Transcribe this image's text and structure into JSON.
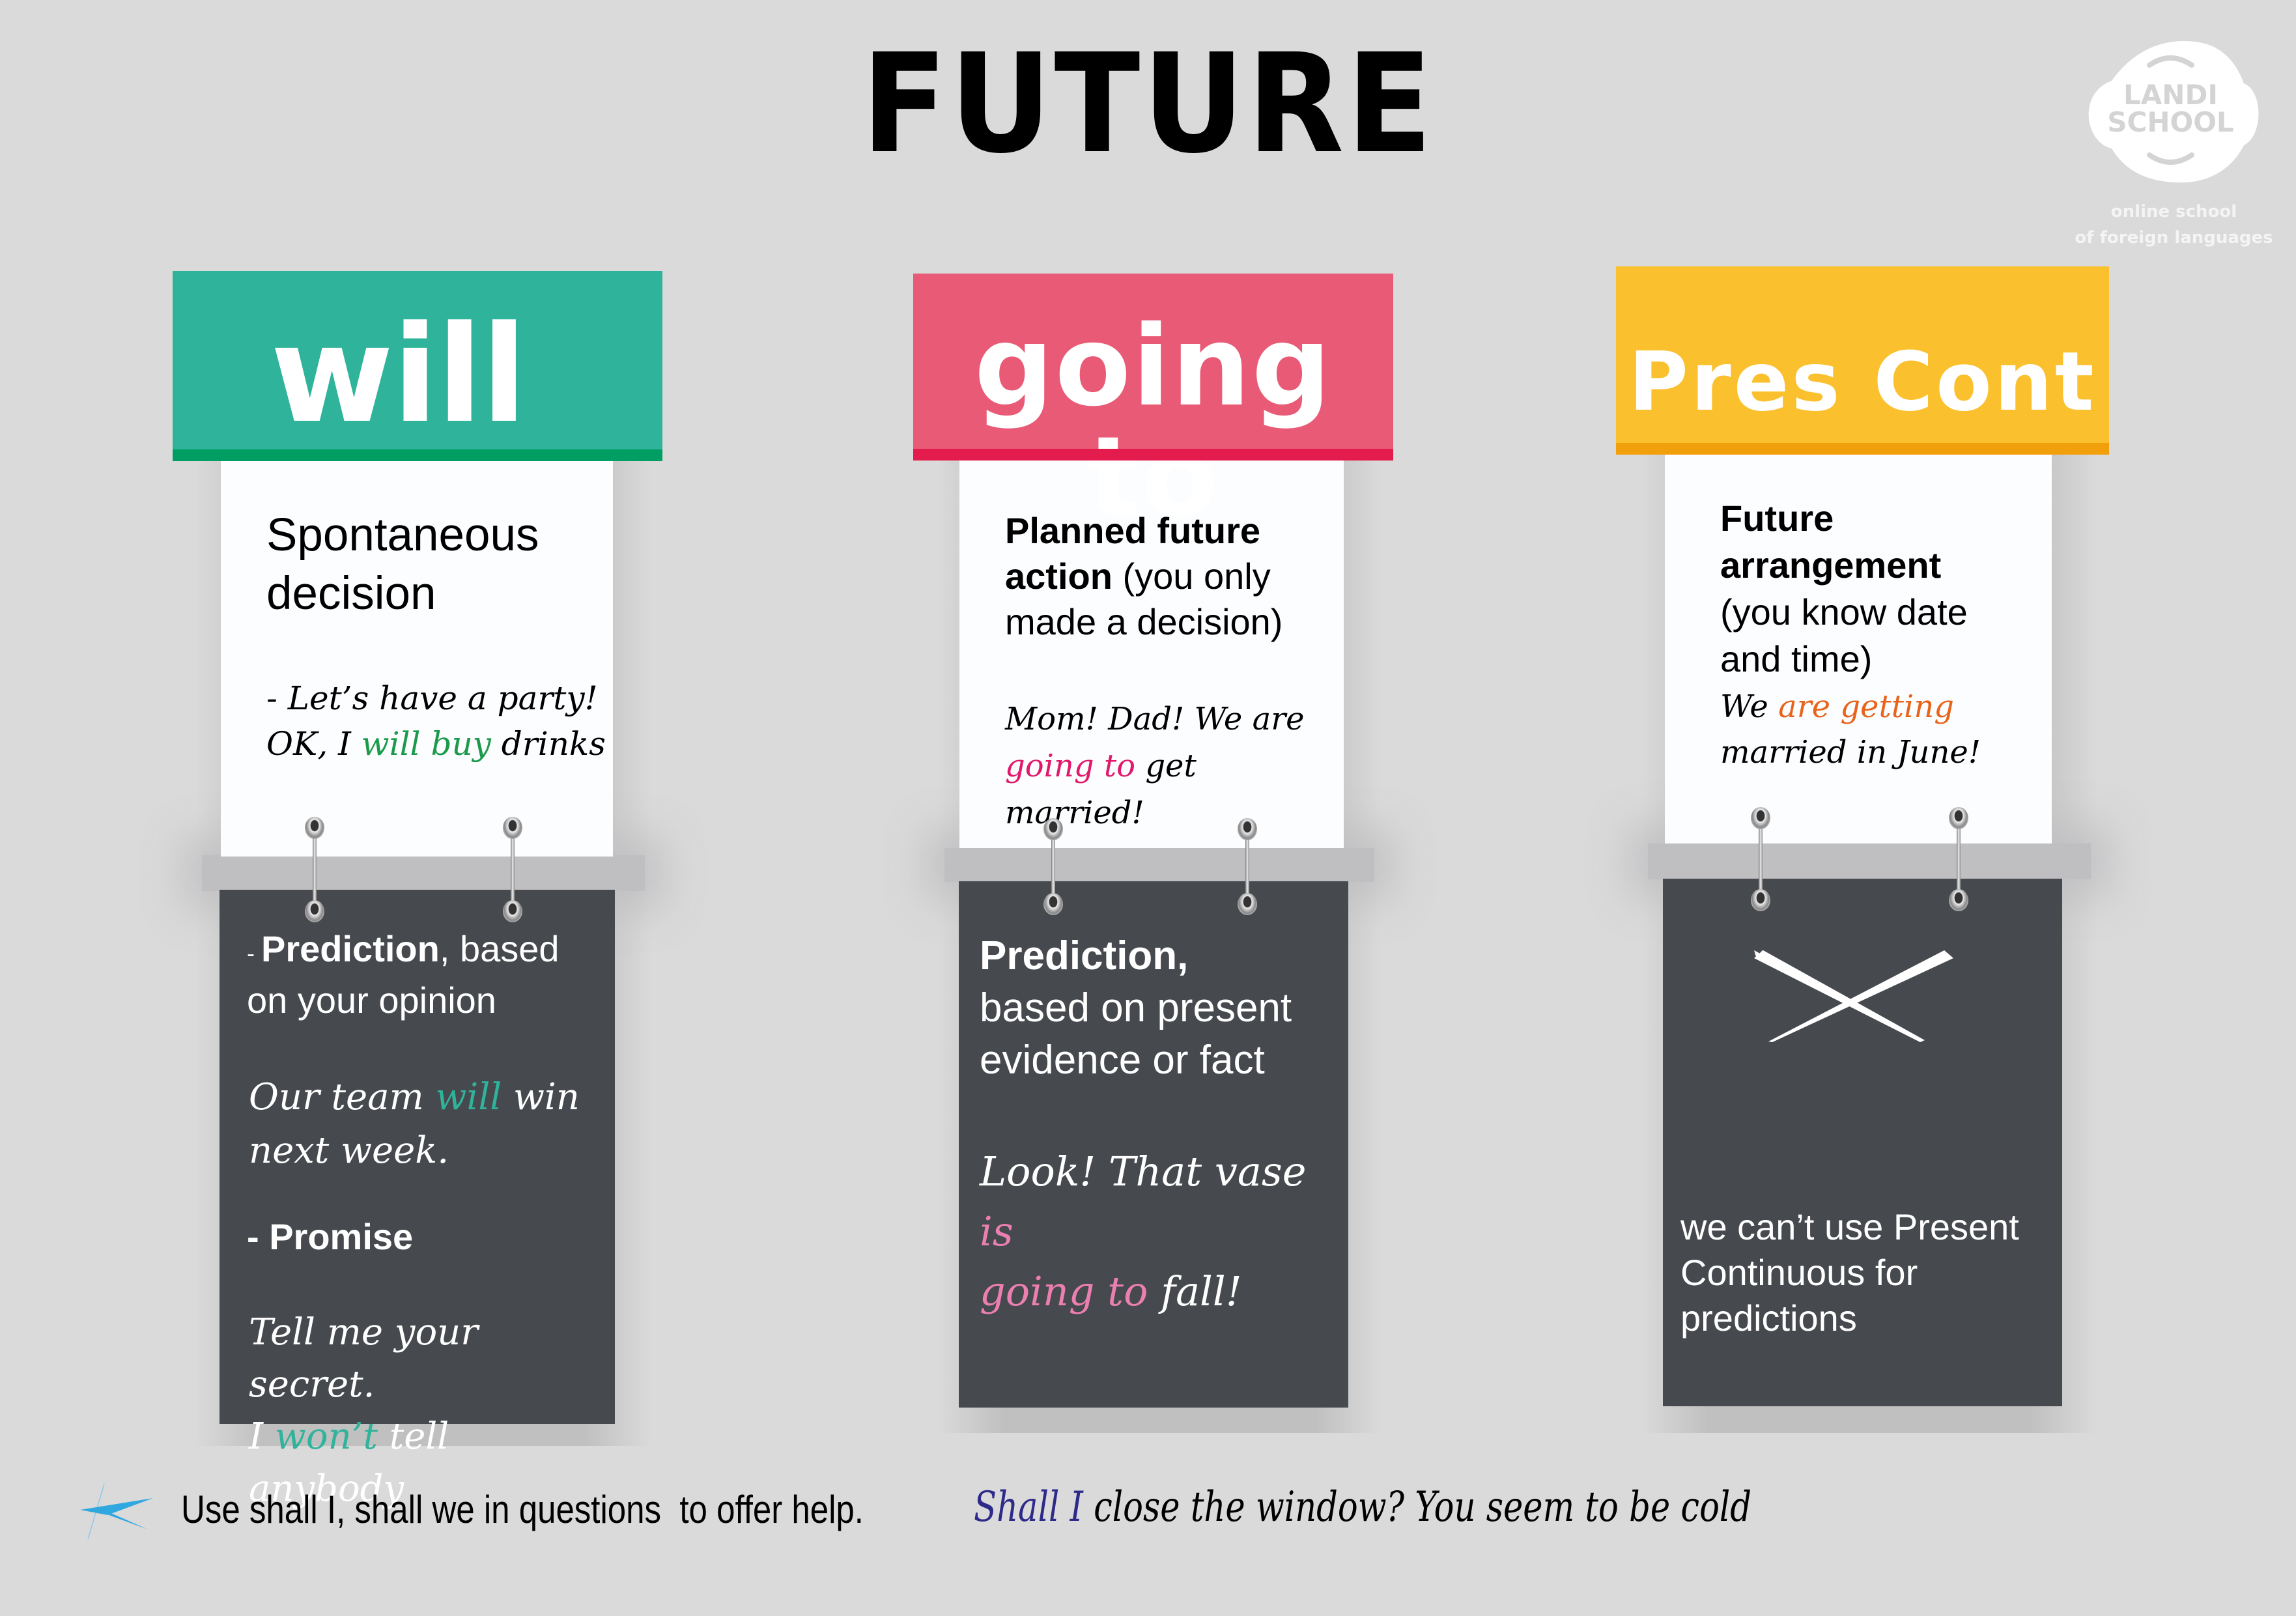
{
  "title": "FUTURE",
  "logo": {
    "line1": "LANDI",
    "line2": "SCHOOL",
    "sub1": "online school",
    "sub2": "of foreign languages"
  },
  "colors": {
    "background": "#dadada",
    "will": "#2fb39a",
    "will_bar": "#009e63",
    "going_to": "#e95a76",
    "going_to_bar": "#e41b4d",
    "pres_cont": "#fbc02d",
    "pres_cont_bar": "#f29f0c",
    "card_dark": "#46494e",
    "card_white": "#fcfdff"
  },
  "columns": [
    {
      "header": "will",
      "white_card": {
        "heading": "Spontaneous decision",
        "heading_line1": "Spontaneous",
        "heading_line2": "decision",
        "example_line1": "- Let’s have a party!",
        "example_line2_pre": "OK, I ",
        "example_line2_hl": "will buy",
        "example_line2_post": " drinks"
      },
      "dark_card": {
        "item1_dash": "- ",
        "item1_bold": "Prediction",
        "item1_rest_line1": ", based",
        "item1_rest_line2": "on your opinion",
        "example1_pre": "Our team ",
        "example1_hl": "will",
        "example1_post": " win",
        "example1_line2": "next week.",
        "item2": "- Promise",
        "example2_line1": "Tell me your secret.",
        "example2_pre": "I ",
        "example2_hl": "won’t",
        "example2_post": " tell anybody"
      }
    },
    {
      "header": "going to",
      "white_card": {
        "heading_bold_line1": "Planned future",
        "heading_bold_line2": "action",
        "heading_rest_line2": " (you only",
        "heading_line3": "made a decision)",
        "example_line1": "Mom! Dad! We are",
        "example_line2_hl": "going to",
        "example_line2_post": " get married!"
      },
      "dark_card": {
        "heading_bold": "Prediction,",
        "heading_line2": "based on present",
        "heading_line3": "evidence or fact",
        "example_line1_pre": "Look! That vase ",
        "example_line1_hl": "is",
        "example_line2_hl": "going to",
        "example_line2_post": " fall!"
      }
    },
    {
      "header": "Pres Cont",
      "white_card": {
        "heading_bold_line1": "Future",
        "heading_bold_line2": "arrangement",
        "heading_line3": "(you know date",
        "heading_line4": "and time)",
        "example_line1_pre": "We ",
        "example_line1_hl": "are getting",
        "example_line2": "married in June!"
      },
      "dark_card": {
        "icon": "cross-icon",
        "text_line1": "we can’t use Present",
        "text_line2": "Continuous for",
        "text_line3": "predictions"
      }
    }
  ],
  "footer": {
    "icon": "star-cross-icon",
    "text": "Use shall I, shall we in questions  to offer help. ",
    "example_hl": "Shall I",
    "example_rest": " close the window? You seem to be cold"
  }
}
